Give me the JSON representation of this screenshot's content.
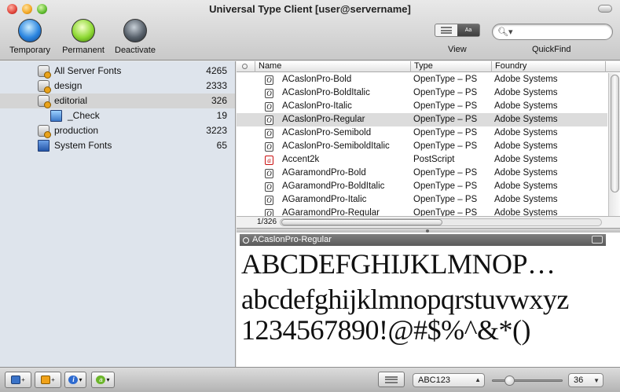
{
  "window": {
    "title": "Universal Type Client [user@servername]"
  },
  "toolbar": {
    "buttons": [
      {
        "label": "Temporary"
      },
      {
        "label": "Permanent"
      },
      {
        "label": "Deactivate"
      }
    ],
    "view_label": "View",
    "quickfind_label": "QuickFind",
    "view_mode_preview_glyph": "Aa",
    "search_value": ""
  },
  "sidebar": {
    "items": [
      {
        "name": "All Server Fonts",
        "count": "4265",
        "icon": "server-database-icon"
      },
      {
        "name": "design",
        "count": "2333",
        "icon": "server-database-icon"
      },
      {
        "name": "editorial",
        "count": "326",
        "icon": "server-database-icon",
        "selected": true
      },
      {
        "name": "_Check",
        "count": "19",
        "icon": "workgroup-icon"
      },
      {
        "name": "production",
        "count": "3223",
        "icon": "server-database-icon"
      },
      {
        "name": "System Fonts",
        "count": "65",
        "icon": "computer-icon"
      }
    ]
  },
  "fontlist": {
    "columns": [
      "Name",
      "Type",
      "Foundry"
    ],
    "rows": [
      {
        "name": "ACaslonPro-Bold",
        "type": "OpenType – PS",
        "foundry": "Adobe Systems"
      },
      {
        "name": "ACaslonPro-BoldItalic",
        "type": "OpenType – PS",
        "foundry": "Adobe Systems"
      },
      {
        "name": "ACaslonPro-Italic",
        "type": "OpenType – PS",
        "foundry": "Adobe Systems"
      },
      {
        "name": "ACaslonPro-Regular",
        "type": "OpenType – PS",
        "foundry": "Adobe Systems",
        "selected": true
      },
      {
        "name": "ACaslonPro-Semibold",
        "type": "OpenType – PS",
        "foundry": "Adobe Systems"
      },
      {
        "name": "ACaslonPro-SemiboldItalic",
        "type": "OpenType – PS",
        "foundry": "Adobe Systems"
      },
      {
        "name": "Accent2k",
        "type": "PostScript",
        "foundry": "Adobe Systems"
      },
      {
        "name": "AGaramondPro-Bold",
        "type": "OpenType – PS",
        "foundry": "Adobe Systems"
      },
      {
        "name": "AGaramondPro-BoldItalic",
        "type": "OpenType – PS",
        "foundry": "Adobe Systems"
      },
      {
        "name": "AGaramondPro-Italic",
        "type": "OpenType – PS",
        "foundry": "Adobe Systems"
      },
      {
        "name": "AGaramondPro-Regular",
        "type": "OpenType – PS",
        "foundry": "Adobe Systems"
      }
    ],
    "count_label": "1/326"
  },
  "preview": {
    "font_name": "ACaslonPro-Regular",
    "line1": "ABCDEFGHIJKLMNOP…",
    "line2": "abcdefghijklmnopqrstuvwxyz",
    "line3": "1234567890!@#$%^&*()"
  },
  "bottombar": {
    "preview_mode": "ABC123",
    "size": "36",
    "size_slider_fraction": 0.2
  }
}
